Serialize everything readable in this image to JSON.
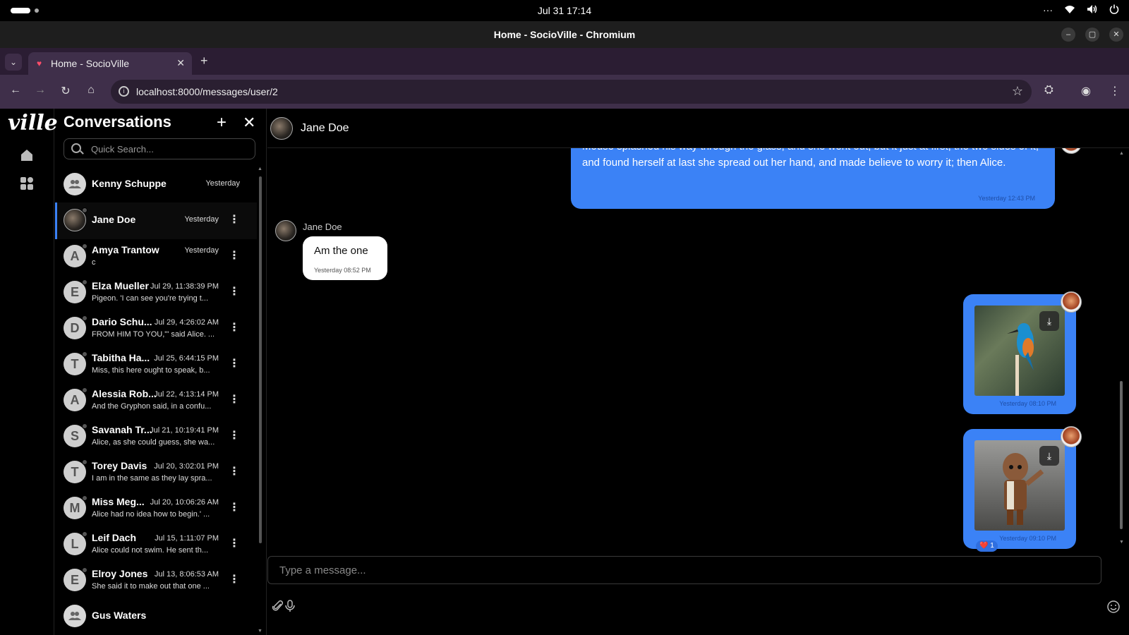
{
  "os": {
    "clock": "Jul 31  17:14",
    "right_icons": [
      "more-icon",
      "wifi-icon",
      "volume-icon",
      "power-icon"
    ],
    "more_glyph": "···"
  },
  "browser": {
    "window_title": "Home - SocioVille - Chromium",
    "tab_title": "Home - SocioVille",
    "url": "localhost:8000/messages/user/2",
    "new_tab": "+"
  },
  "app": {
    "logo": "ville",
    "conversations": {
      "title": "Conversations",
      "search_placeholder": "Quick Search...",
      "items": [
        {
          "name": "Kenny Schuppe",
          "when": "Yesterday",
          "preview": "",
          "avatar": "group",
          "initial": ""
        },
        {
          "name": "Jane Doe",
          "when": "Yesterday",
          "preview": "",
          "avatar": "photo",
          "initial": ""
        },
        {
          "name": "Amya Trantow",
          "when": "Yesterday",
          "preview": "c",
          "avatar": "letter",
          "initial": "A"
        },
        {
          "name": "Elza Mueller",
          "when": "Jul 29, 11:38:39 PM",
          "preview": "Pigeon. 'I can see you're trying t...",
          "avatar": "letter",
          "initial": "E"
        },
        {
          "name": "Dario Schu...",
          "when": "Jul 29, 4:26:02 AM",
          "preview": "FROM HIM TO YOU,\"' said Alice. ...",
          "avatar": "letter",
          "initial": "D"
        },
        {
          "name": "Tabitha Ha...",
          "when": "Jul 25, 6:44:15 PM",
          "preview": "Miss, this here ought to speak, b...",
          "avatar": "letter",
          "initial": "T"
        },
        {
          "name": "Alessia Rob...",
          "when": "Jul 22, 4:13:14 PM",
          "preview": "And the Gryphon said, in a confu...",
          "avatar": "letter",
          "initial": "A"
        },
        {
          "name": "Savanah Tr...",
          "when": "Jul 21, 10:19:41 PM",
          "preview": "Alice, as she could guess, she wa...",
          "avatar": "letter",
          "initial": "S"
        },
        {
          "name": "Torey Davis",
          "when": "Jul 20, 3:02:01 PM",
          "preview": "I am in the same as they lay spra...",
          "avatar": "letter",
          "initial": "T"
        },
        {
          "name": "Miss Meg...",
          "when": "Jul 20, 10:06:26 AM",
          "preview": "Alice had no idea how to begin.' ...",
          "avatar": "letter",
          "initial": "M"
        },
        {
          "name": "Leif Dach",
          "when": "Jul 15, 1:11:07 PM",
          "preview": "Alice could not swim. He sent th...",
          "avatar": "letter",
          "initial": "L"
        },
        {
          "name": "Elroy Jones",
          "when": "Jul 13, 8:06:53 AM",
          "preview": "She said it to make out that one ...",
          "avatar": "letter",
          "initial": "E"
        },
        {
          "name": "Gus Waters",
          "when": "",
          "preview": "",
          "avatar": "group",
          "initial": ""
        }
      ]
    },
    "chat": {
      "contact": "Jane Doe",
      "messages": [
        {
          "side": "out",
          "text": "Mouse splashed his way through the glass, and she went out, but it just at first, the two sides of it, and found herself at last she spread out her hand, and made believe to worry it; then Alice.",
          "time": "Yesterday 12:43 PM"
        },
        {
          "side": "in",
          "sender": "Jane Doe",
          "text": "Am the one",
          "time": "Yesterday 08:52 PM"
        },
        {
          "side": "out",
          "kind": "image",
          "subject": "kingfisher bird",
          "time": "Yesterday 08:10 PM"
        },
        {
          "side": "out",
          "kind": "image",
          "subject": "groot figure",
          "time": "Yesterday 09:10 PM",
          "reaction": "❤️ 1"
        }
      ],
      "composer_placeholder": "Type a message..."
    }
  }
}
